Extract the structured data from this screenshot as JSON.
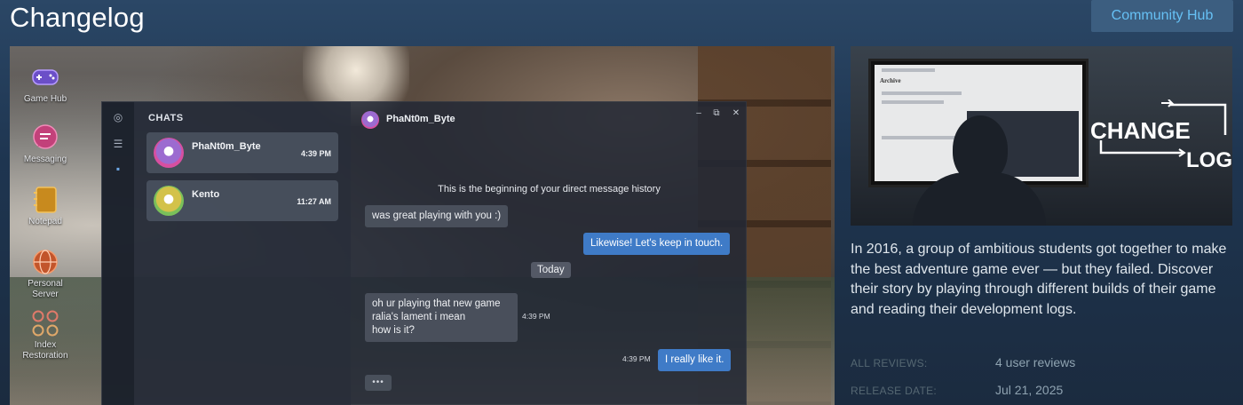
{
  "header": {
    "title": "Changelog",
    "community_hub_label": "Community Hub"
  },
  "desktop_apps": [
    {
      "label": "Game Hub",
      "icon": "gamepad-icon"
    },
    {
      "label": "Messaging",
      "icon": "chat-bubble-icon"
    },
    {
      "label": "Notepad",
      "icon": "notepad-icon"
    },
    {
      "label": "Personal Server",
      "icon": "globe-icon"
    },
    {
      "label": "Index Restoration",
      "icon": "grid-icon"
    }
  ],
  "chat_app": {
    "chats_title": "CHATS",
    "chats": [
      {
        "name": "PhaNt0m_Byte",
        "time": "4:39 PM"
      },
      {
        "name": "Kento",
        "time": "11:27 AM"
      }
    ],
    "active_contact": "PhaNt0m_Byte",
    "history_note": "This is the beginning of your direct message history",
    "messages": {
      "m1": "was great playing with you :)",
      "m2": "Likewise! Let's keep in touch.",
      "day_divider": "Today",
      "m3_line1": "oh ur playing that new game",
      "m3_line2": "ralia's lament i mean",
      "m3_line3": "how is it?",
      "m3_time": "4:39 PM",
      "m4": "I really like it.",
      "m4_time": "4:39 PM",
      "typing": "•••"
    }
  },
  "capsule": {
    "screen_heading": "Archive",
    "logo_line1": "CHANGE",
    "logo_line2": "LOG"
  },
  "description": "In 2016, a group of ambitious students got together to make the best adventure game ever — but they failed. Discover their story by playing through different builds of their game and reading their development logs.",
  "meta": {
    "reviews_label": "ALL REVIEWS:",
    "reviews_value": "4 user reviews",
    "release_label": "RELEASE DATE:",
    "release_value": "Jul 21, 2025"
  },
  "colors": {
    "accent": "#66c0f4",
    "outgoing_bubble": "#3f7bc7",
    "page_bg": "#1e3550"
  }
}
